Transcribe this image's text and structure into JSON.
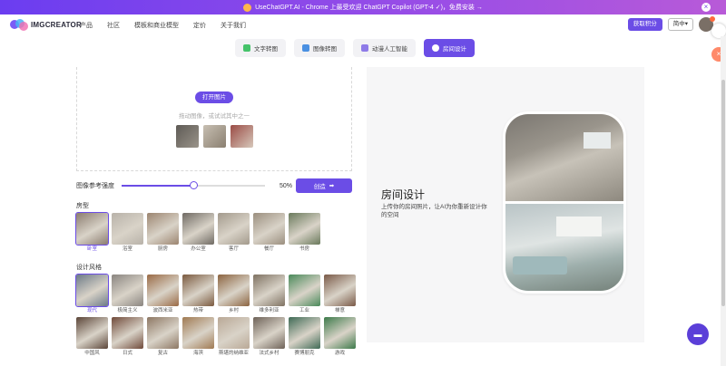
{
  "banner": {
    "text": "UseChatGPT.AI - Chrome 上最受欢迎 ChatGPT Copilot (GPT-4 ✓)，免费安装 →",
    "close": "×"
  },
  "brand": {
    "name": "IMGCREATOR"
  },
  "nav": {
    "links": [
      "产品",
      "社区",
      "模板和商业模型",
      "定价",
      "关于我们"
    ]
  },
  "account": {
    "signup": "获取积分",
    "lang": "简中▾"
  },
  "tabs": [
    {
      "label": "文字转图",
      "active": false,
      "color": "#45c36a"
    },
    {
      "label": "图像转图",
      "active": false,
      "color": "#4a90e2"
    },
    {
      "label": "动漫人工智能",
      "active": false,
      "color": "#8e7be8"
    },
    {
      "label": "房间设计",
      "active": true,
      "color": "#ffffff"
    }
  ],
  "upload": {
    "button": "打开图片",
    "hint": "拖动图像，或试试其中之一",
    "samples": [
      "#6e6a63",
      "#a39a8d",
      "#7d5a4e"
    ]
  },
  "slider": {
    "label": "图像参考强度",
    "value": "50%",
    "fraction": 0.5
  },
  "generate": {
    "label": "创造",
    "icon": "arrow-right-icon"
  },
  "room_type": {
    "title": "房型",
    "items": [
      {
        "label": "卧室",
        "selected": true,
        "color": "#8b7c6f"
      },
      {
        "label": "浴室",
        "selected": false,
        "color": "#b8b2a9"
      },
      {
        "label": "厨房",
        "selected": false,
        "color": "#9c8570"
      },
      {
        "label": "办公室",
        "selected": false,
        "color": "#6f6a63"
      },
      {
        "label": "客厅",
        "selected": false,
        "color": "#a39a8c"
      },
      {
        "label": "餐厅",
        "selected": false,
        "color": "#9b8f7f"
      },
      {
        "label": "书房",
        "selected": false,
        "color": "#6a7a5c"
      }
    ]
  },
  "design_style": {
    "title": "设计风格",
    "items": [
      {
        "label": "现代",
        "selected": true,
        "color": "#6c7a87"
      },
      {
        "label": "极简主义",
        "selected": false,
        "color": "#8a8580"
      },
      {
        "label": "波西米亚",
        "selected": false,
        "color": "#9a6a45"
      },
      {
        "label": "热带",
        "selected": false,
        "color": "#7b5a3f"
      },
      {
        "label": "乡村",
        "selected": false,
        "color": "#8c6440"
      },
      {
        "label": "维多利亚",
        "selected": false,
        "color": "#7f7262"
      },
      {
        "label": "工业",
        "selected": false,
        "color": "#4a8a5a"
      },
      {
        "label": "禅意",
        "selected": false,
        "color": "#7a5a48"
      },
      {
        "label": "中国风",
        "selected": false,
        "color": "#5b4538"
      },
      {
        "label": "日式",
        "selected": false,
        "color": "#704a3a"
      },
      {
        "label": "复古",
        "selected": false,
        "color": "#8d7763"
      },
      {
        "label": "海滨",
        "selected": false,
        "color": "#a07a52"
      },
      {
        "label": "斯堪的纳维亚",
        "selected": false,
        "color": "#b9a896"
      },
      {
        "label": "法式乡村",
        "selected": false,
        "color": "#6e6258"
      },
      {
        "label": "赛博朋克",
        "selected": false,
        "color": "#3f6a55"
      },
      {
        "label": "游戏",
        "selected": false,
        "color": "#3d7a4a"
      }
    ]
  },
  "preview": {
    "title": "房间设计",
    "description": "上传你的房间照片，让AI为你重新设计你的空间"
  },
  "chat": {
    "icon": "chat-bubble-icon"
  },
  "colors": {
    "accent": "#6b4de6"
  }
}
